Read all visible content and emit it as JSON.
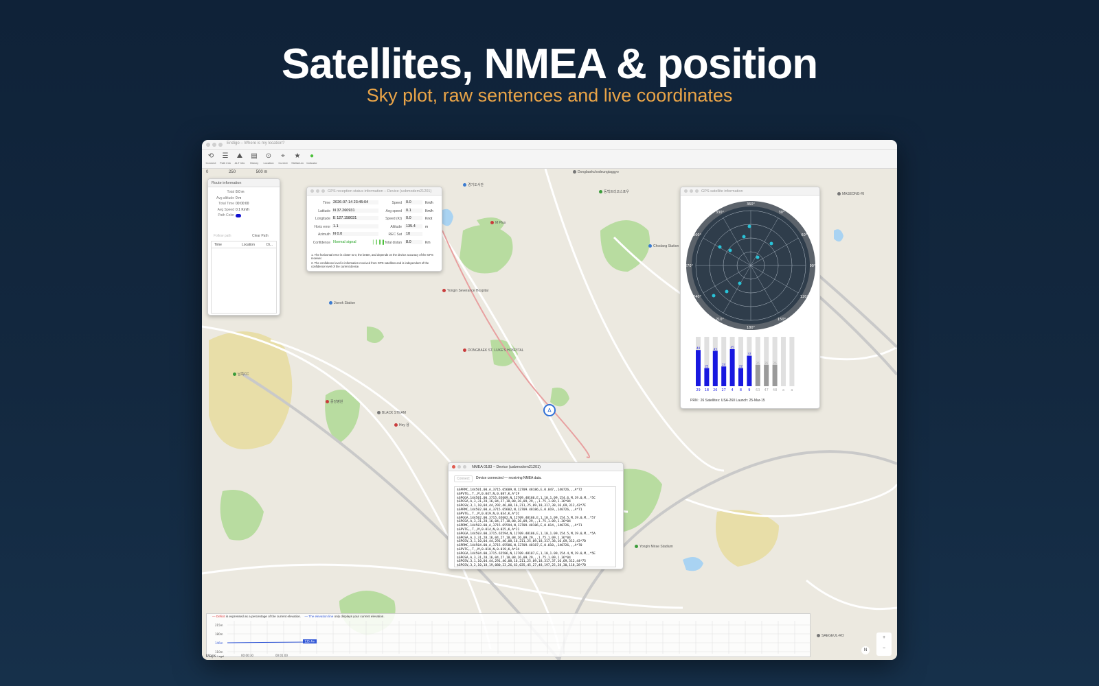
{
  "hero": {
    "title": "Satellites, NMEA & position",
    "subtitle": "Sky plot, raw sentences and live coordinates"
  },
  "window": {
    "title": "Endigo – Where is my location?",
    "toolbar": [
      {
        "label": "Connect",
        "icon": "connect-icon",
        "glyph": "⟲"
      },
      {
        "label": "Path Info",
        "icon": "path-info-icon",
        "glyph": "☰"
      },
      {
        "label": "ALT Info",
        "icon": "altitude-icon",
        "glyph": "⛰"
      },
      {
        "label": "History",
        "icon": "history-icon",
        "glyph": "▤"
      },
      {
        "label": "Location",
        "icon": "location-icon",
        "glyph": "⊙"
      },
      {
        "label": "Current",
        "icon": "current-icon",
        "glyph": "⌖"
      },
      {
        "label": "Stellarium",
        "icon": "stellarium-icon",
        "glyph": "★"
      },
      {
        "label": "Indicator",
        "icon": "indicator-icon",
        "glyph": "●"
      }
    ]
  },
  "map": {
    "scale": {
      "zero": "0",
      "mid": "250",
      "end": "500 m"
    },
    "pois": [
      {
        "label": "Dongbaekchodeungtaggyo",
        "color": "#777"
      },
      {
        "label": "동백트리코스포우",
        "color": "#3b9c3b"
      },
      {
        "label": "경기도서관",
        "color": "#3b7bd0"
      },
      {
        "label": "M Plus",
        "color": "#c93c3c"
      },
      {
        "label": "Yongin Severance Hospital",
        "color": "#c93c3c"
      },
      {
        "label": "DONGBAEK ST. LUKE'S HOSPITAL",
        "color": "#c93c3c"
      },
      {
        "label": "Jiseok Station",
        "color": "#3b7bd0"
      },
      {
        "label": "BLACK STEAM",
        "color": "#777"
      },
      {
        "label": "Hey 용",
        "color": "#c93c3c"
      },
      {
        "label": "Chodang Station",
        "color": "#3b7bd0"
      },
      {
        "label": "남쪽CC",
        "color": "#3b9c3b"
      },
      {
        "label": "중앙병원",
        "color": "#c93c3c"
      },
      {
        "label": "Yongin Mirae Stadium",
        "color": "#3b9c3b"
      },
      {
        "label": "MASEONG-RI",
        "color": "#777"
      },
      {
        "label": "SAEGEUL-RO",
        "color": "#777"
      }
    ],
    "attribution": "Maps",
    "legal": "Legal",
    "compass": "N"
  },
  "route_panel": {
    "title": "Route information",
    "rows": [
      {
        "label": "Total",
        "value": "8.0 m"
      },
      {
        "label": "Avg altitude",
        "value": "0 m"
      },
      {
        "label": "Total Time",
        "value": "00:00:00"
      },
      {
        "label": "Avg Speed",
        "value": "0.1 Km/h"
      },
      {
        "label": "Path Color",
        "value": ""
      }
    ],
    "follow_path": "Follow path",
    "clear_path": "Clear Path",
    "columns": [
      "Time",
      "Location",
      "Di..."
    ]
  },
  "gps_panel": {
    "title": "GPS reception status information – Device (usbmodem21201)",
    "left": [
      {
        "label": "Time",
        "value": "2026-07-14 23:45:04"
      },
      {
        "label": "Latitude",
        "value": "N 37.260931"
      },
      {
        "label": "Longitude",
        "value": "E 127.158031"
      },
      {
        "label": "Horiz error",
        "value": "1.1"
      },
      {
        "label": "Azimuth",
        "value": "N 0.0"
      },
      {
        "label": "Confidence",
        "value": "Normal signal"
      }
    ],
    "right": [
      {
        "label": "Speed",
        "value": "0.0",
        "unit": "Km/h"
      },
      {
        "label": "Avg speed",
        "value": "0.1",
        "unit": "Km/h"
      },
      {
        "label": "Speed (Kt)",
        "value": "0.0",
        "unit": "Knot"
      },
      {
        "label": "Altitude",
        "value": "135.4",
        "unit": "m"
      },
      {
        "label": "REC Sat",
        "value": "10",
        "unit": ""
      },
      {
        "label": "Total distan",
        "value": "8.0",
        "unit": "Km"
      }
    ],
    "note1": "1. The horizontal error is closer to 0, the better, and depends on the device accuracy of the GPS receiver.",
    "note2": "2. The confidence level is information received from GPS satellites and is independent of the confidence level of the current device."
  },
  "sat_panel": {
    "title": "GPS satellite information",
    "sky_labels": [
      "360°",
      "30°",
      "60°",
      "90°",
      "120°",
      "150°",
      "180°",
      "210°",
      "240°",
      "270°",
      "300°",
      "330°"
    ],
    "bars": [
      {
        "prn": "29",
        "snr": 44,
        "active": true
      },
      {
        "prn": "18",
        "snr": 22,
        "active": true
      },
      {
        "prn": "26",
        "snr": 43,
        "active": true
      },
      {
        "prn": "27",
        "snr": 24,
        "active": true
      },
      {
        "prn": "4",
        "snr": 45,
        "active": true
      },
      {
        "prn": "8",
        "snr": 22,
        "active": true
      },
      {
        "prn": "9",
        "snr": 37,
        "active": true
      },
      {
        "prn": "63",
        "snr": 26,
        "active": false
      },
      {
        "prn": "47",
        "snr": 26,
        "active": false
      },
      {
        "prn": "48",
        "snr": 26,
        "active": false
      },
      {
        "prn": "a",
        "snr": 0,
        "active": false
      },
      {
        "prn": "a",
        "snr": 0,
        "active": false
      }
    ],
    "footer": "PRN : 26 Satellites: USA-260 Launch: 25-Mar-15"
  },
  "nmea_panel": {
    "title": "NMEA 0183 – Device (usbmodem21201)",
    "connect": "Connect",
    "status": "Device connected — receiving NMEA data.",
    "lines": [
      "$GPRMC,144501.00,A,3715.65609,N,12709.48186,E,0.047,,140726,,,A*72",
      "$GPVTG,,T,,M,0.047,N,0.087,K,A*2F",
      "$GPGGA,144501.00,3715.65609,N,12709.48186,E,1,10,1.09,154.6,M,19.0,M,,*5C",
      "$GPGSA,A,3,31,28,16,04,27,18,08,26,09,29,,,1.75,1.09,1.36*04",
      "$GPGSV,3,1,10,04,44,292,46,08,16,211,25,09,18,317,38,16,69,312,43*7E",
      "$GPRMC,144502.00,A,3715.65602,N,12709.48186,E,0.019,,140726,,,A*71",
      "$GPVTG,,T,,M,0.019,N,0.034,K,A*2C",
      "$GPGGA,144502.00,3715.65602,N,12709.48186,E,1,10,1.09,154.5,M,19.0,M,,*57",
      "$GPGSA,A,3,31,28,16,04,27,18,08,26,09,29,,,1.75,1.09,1.36*04",
      "$GPRMC,144503.00,A,3715.65594,N,12709.48186,E,0.014,,140726,,,A*71",
      "$GPVTG,,T,,M,0.014,N,0.025,K,A*21",
      "$GPGGA,144503.00,3715.65594,N,12709.48186,E,1,10,1.09,154.5,M,19.0,M,,*5A",
      "$GPGSA,A,3,31,28,16,04,27,18,08,26,09,29,,,1.75,1.09,1.36*04",
      "$GPGSV,3,1,10,04,44,291,46,08,16,211,25,09,18,317,38,16,69,312,43*7D",
      "$GPRMC,144504.00,A,3715.65586,N,12709.48187,E,0.010,,140726,,,A*70",
      "$GPVTG,,T,,M,0.010,N,0.019,K,A*2A",
      "$GPGGA,144504.00,3715.65586,N,12709.48187,E,1,10,1.09,154.4,M,19.0,M,,*5E",
      "$GPGSA,A,3,31,28,16,04,27,18,08,26,09,29,,,1.75,1.09,1.36*04",
      "$GPGSV,3,1,10,04,44,291,46,08,16,211,25,09,18,317,37,16,69,312,44*75",
      "$GPGSV,3,2,10,18,19,080,23,26,63,035,45,27,48,197,25,28,30,118,28*7D"
    ]
  },
  "elevation": {
    "note_red": "— Deficit",
    "note_text1": " is expressed as a percentage of the current elevation.",
    "note_blue": "— The elevation line",
    "note_text2": " only displays your current elevation.",
    "y_labels": [
      "215m",
      "180m",
      "146m",
      "110m"
    ],
    "x_labels": [
      "00:00:30",
      "00:01:00"
    ],
    "marker": "135.4m"
  }
}
